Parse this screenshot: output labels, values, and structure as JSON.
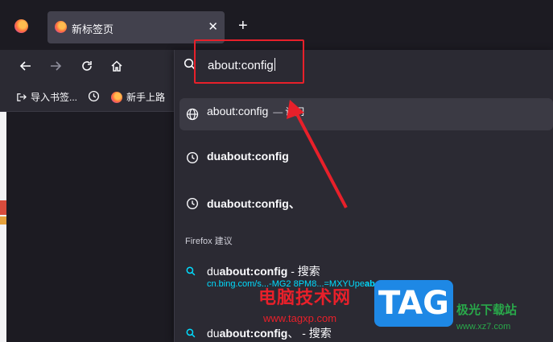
{
  "tab": {
    "title": "新标签页"
  },
  "urlbar": {
    "value": "about:config"
  },
  "bookmarks": [
    {
      "label": "导入书签..."
    },
    {
      "label": "新手上路"
    }
  ],
  "dropdown": {
    "visit_row": {
      "text": "about:config",
      "separator": "—",
      "action": "访问"
    },
    "history": [
      {
        "text": "duabout:config"
      },
      {
        "text": "duabout:config、"
      }
    ],
    "section_heading": "Firefox 建议",
    "suggestions": [
      {
        "prefix": "du",
        "bold": "about:config",
        "suffix": " - 搜索",
        "url_prefix": "cn.bing.com/s",
        "url_mid": "...-MG2 8PM8...=MXYUpe",
        "url_bold": "about:config"
      },
      {
        "prefix": "du",
        "bold": "about:config",
        "suffix": "、 - 搜索"
      }
    ]
  },
  "watermark": {
    "brand_cn": "电脑技术网",
    "brand_url": "www.tagxp.com",
    "tag": "TAG",
    "site_cn": "极光下载站",
    "site_url": "www.xz7.com"
  },
  "colors": {
    "annotation": "#e8202a",
    "link": "#00ddff",
    "panel": "#2b2a33"
  }
}
